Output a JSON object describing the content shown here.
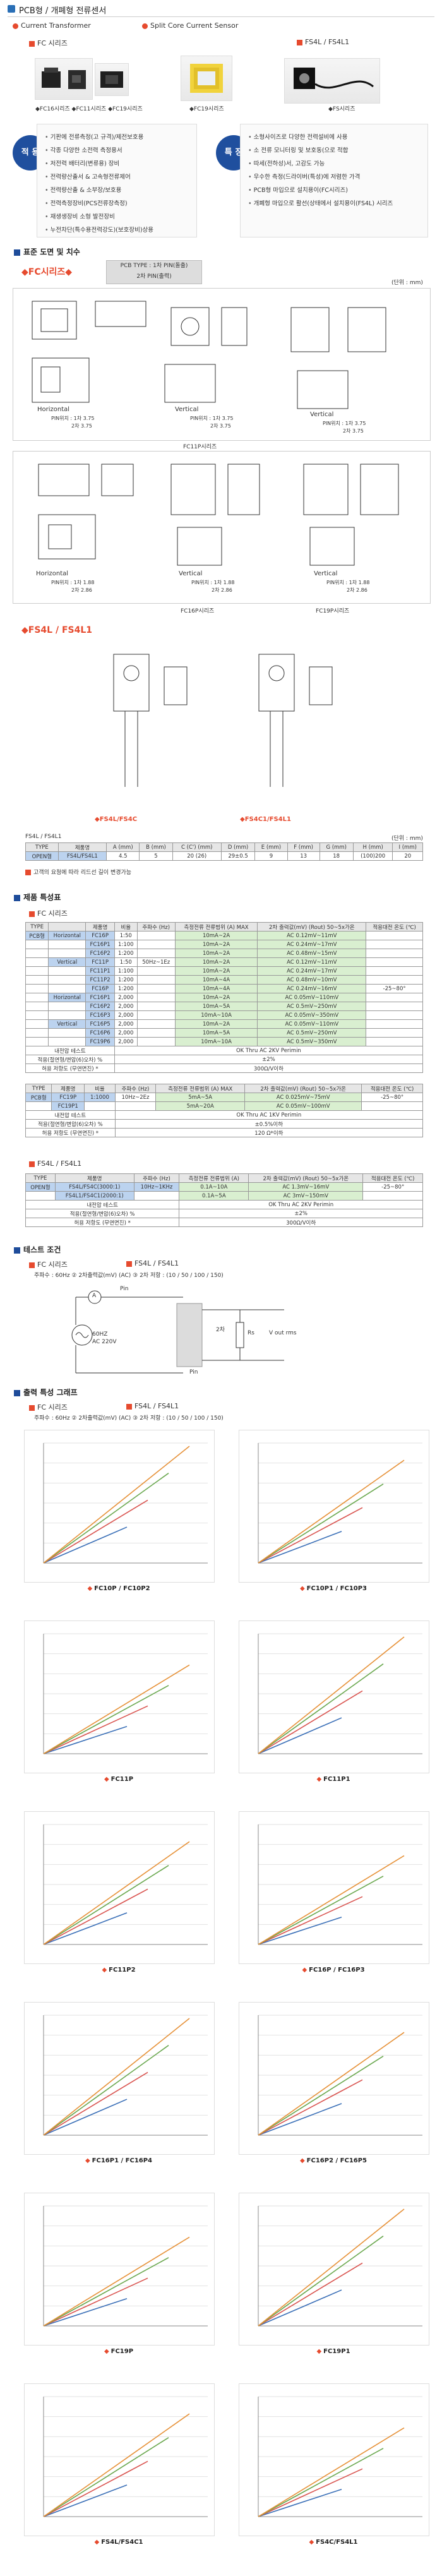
{
  "header": {
    "title": "PCB형 / 개폐형 전류센서"
  },
  "subtitle": {
    "ct": "Current Transformer",
    "split": "Split Core Current Sensor"
  },
  "series": {
    "fc": "FC 시리즈",
    "fs": "FS4L / FS4L1"
  },
  "photo_captions": {
    "fc": "◆FC16시리즈 ◆FC11시리즈 ◆FC19시리즈",
    "fc2": "◆FC19시리즈",
    "fs": "◆FS시리즈"
  },
  "features": {
    "use_label": "적 용",
    "feat_label": "특 징",
    "use_items": [
      "기판에 전류측정(고 규격)/제전보호용",
      "각종 다양한 소전력 측정용서",
      "저전력 배터리(변류용) 장비",
      "전력량산출서 & 고속형전류제어",
      "전력량산출 & 소부장/보호용",
      "전력측정장비(PCS전류장측정)",
      "재생생장비 소형 발전장비",
      "누전차단(특수용전력강도)(보호장비)상용"
    ],
    "feat_items": [
      "소형사이즈로 다양한 전력설비에 사용",
      "소 전류 모니터링 및 보호동(으로 적합",
      "따세(전하성)서, 고감도 가능",
      "우수한 측정(드라이버(특성)에 저렴한 가격",
      "PCB형 마입으로 설치용이(FC시리즈)",
      "개폐형 마입으로 활선(상태에서 설치용이(FS4L) 시리즈"
    ]
  },
  "s1": {
    "title": "표준 도면 및 치수",
    "fc_head": "FC시리즈",
    "pcb_type": [
      "PCB TYPE : 1차 PIN(돌출)",
      "2차 PIN(출력)"
    ],
    "unit": "(단위 : mm)",
    "d1": {
      "h": "Horizontal",
      "pin1": "PIN위치 : 1차 3.75",
      "pin2": "2차 3.75",
      "cap": "FC16P시리즈"
    },
    "d2": {
      "v": "Vertical",
      "pin1": "PIN위치 : 1차 3.75",
      "pin2": "2차 3.75",
      "cap": "FC11P시리즈"
    },
    "d3": {
      "v": "Vertical",
      "pin1": "PIN위치 : 1차 3.75",
      "pin2": "2차 3.75"
    },
    "d4": {
      "h": "Horizontal",
      "pin1": "PIN위치 : 1차 1.88",
      "pin2": "2차 2.86"
    },
    "d5": {
      "v": "Vertical",
      "pin1": "PIN위치 : 1차 1.88",
      "pin2": "2차 2.86",
      "cap": "FC16P시리즈"
    },
    "d6": {
      "v": "Vertical",
      "pin1": "PIN위치 : 1차 1.88",
      "pin2": "2차 2.86",
      "cap": "FC19P시리즈"
    },
    "fs_head": "FS4L / FS4L1",
    "fs_cap1": "FS4L/FS4C",
    "fs_cap2": "FS4C1/FS4L1",
    "fs_label": "FS4L / FS4L1",
    "fs_unit": "(단위 : mm)",
    "fs_table": {
      "headers": [
        "TYPE",
        "제품명",
        "A (mm)",
        "B (mm)",
        "C (C') (mm)",
        "D (mm)",
        "E (mm)",
        "F (mm)",
        "G (mm)",
        "H (mm)",
        "I (mm)"
      ],
      "row": [
        "OPEN형",
        "FS4L/FS4L1",
        "4.5",
        "5",
        "20 (26)",
        "29±0.5",
        "9",
        "13",
        "18",
        "(100)200",
        "20"
      ]
    },
    "note": "고객의 요청에 따라 리드선 길이 변경가능"
  },
  "s2": {
    "title": "제품 특성표",
    "fc": "FC 시리즈",
    "t1h": [
      "TYPE",
      "제품명",
      "비율",
      "주파수 (Hz)",
      "측정전류 전류범위 (A) MAX",
      "2차 출력값(mV) (Rout) 50~5x가온",
      "적용대전 온도 (℃)"
    ],
    "t1rows": [
      [
        "PCB형",
        "Horizontal",
        "FC16P",
        "1:50",
        "",
        "10mA~2A",
        "AC 0.12mV~11mV",
        ""
      ],
      [
        "",
        "",
        "FC16P1",
        "1:100",
        "",
        "10mA~2A",
        "AC 0.24mV~17mV",
        ""
      ],
      [
        "",
        "",
        "FC16P2",
        "1:200",
        "",
        "10mA~2A",
        "AC 0.48mV~15mV",
        ""
      ],
      [
        "",
        "Vertical",
        "FC11P",
        "1:50",
        "50Hz~1Ez",
        "10mA~2A",
        "AC 0.12mV~11mV",
        ""
      ],
      [
        "",
        "",
        "FC11P1",
        "1:100",
        "",
        "10mA~2A",
        "AC 0.24mV~17mV",
        ""
      ],
      [
        "",
        "",
        "FC11P2",
        "1:200",
        "",
        "10mA~4A",
        "AC 0.48mV~10mV",
        ""
      ],
      [
        "",
        "",
        "FC16P",
        "1:200",
        "",
        "10mA~4A",
        "AC 0.24mV~16mV",
        "-25~80°"
      ],
      [
        "",
        "Horizontal",
        "FC16P1",
        "2,000",
        "",
        "10mA~2A",
        "AC 0.05mV~110mV",
        ""
      ],
      [
        "",
        "",
        "FC16P2",
        "2,000",
        "",
        "10mA~5A",
        "AC 0.5mV~250mV",
        ""
      ],
      [
        "",
        "",
        "FC16P3",
        "2,000",
        "",
        "10mA~10A",
        "AC 0.05mV~350mV",
        ""
      ],
      [
        "",
        "Vertical",
        "FC16P5",
        "2,000",
        "",
        "10mA~2A",
        "AC 0.05mV~110mV",
        ""
      ],
      [
        "",
        "",
        "FC16P6",
        "2,000",
        "",
        "10mA~5A",
        "AC 0.5mV~250mV",
        ""
      ],
      [
        "",
        "",
        "FC19P6",
        "2,000",
        "",
        "10mA~10A",
        "AC 0.5mV~350mV",
        ""
      ]
    ],
    "t1foot": [
      [
        "내전압 테스트",
        "OK Thru AC 2KV Perimin"
      ],
      [
        "적용(절연형/변압(6)오차) %",
        "±2%"
      ],
      [
        "허용 저항도 (무연면진)  *",
        "300Ω/V이하"
      ]
    ],
    "t2h": [
      "TYPE",
      "제품명",
      "비율",
      "주파수 (Hz)",
      "측정전류 전류범위 (A) MAX",
      "2차 출력값(mV) (Rout) 50~5x가온",
      "적용대전 온도 (℃)"
    ],
    "t2rows": [
      [
        "PCB형",
        "FC19P",
        "1:1000",
        "10Hz~2Ez",
        "5mA~5A",
        "AC 0.025mV~75mV",
        "-25~80°"
      ],
      [
        "",
        "FC19P1",
        "",
        "",
        "5mA~20A",
        "AC 0.05mV~100mV",
        ""
      ]
    ],
    "t2foot": [
      [
        "내전압 테스트",
        "OK Thru AC 1KV Perimin"
      ],
      [
        "적용(절연형/변압(6)오차) %",
        "±0.5%이하"
      ],
      [
        "허용 저항도 (무연면진)  *",
        "120 Ω*이하"
      ]
    ],
    "fs": "FS4L / FS4L1",
    "t3h": [
      "TYPE",
      "제품명",
      "주파수 (Hz)",
      "측정전류 전류범위 (A)",
      "2차 출력값(mV) (Rout) 50~5x가온",
      "적용대전 온도 (℃)"
    ],
    "t3rows": [
      [
        "OPEN형",
        "FS4L/FS4C(3000:1)",
        "10Hz~1KHz",
        "0.1A~10A",
        "AC 1.3mV~16mV",
        "-25~80°"
      ],
      [
        "",
        "FS4L1/FS4C1(2000:1)",
        "",
        "0.1A~5A",
        "AC 3mV~150mV",
        ""
      ]
    ],
    "t3foot": [
      [
        "내전압 테스트",
        "OK Thru AC 2KV Perimin"
      ],
      [
        "적용(절연형/변압(6)오차) %",
        "±2%"
      ],
      [
        "허용 저항도 (무연면진)  *",
        "300Ω/V이하"
      ]
    ]
  },
  "s3": {
    "title": "테스트 조건",
    "fc": "FC 시리즈",
    "fs": "FS4L / FS4L1",
    "cond": "주파수 : 60Hz  ② 2차출력값(mV) (AC)  ③ 2차 저항 : (10 / 50 / 100 / 150)",
    "circuit": {
      "pin": "Pin",
      "a": "A",
      "freq": "60HZ",
      "ac": "AC 220V",
      "r2": "2차",
      "rs": "Rs",
      "vout": "V out rms",
      "pin2": "Pin"
    }
  },
  "s4": {
    "title": "출력 특성 그래프",
    "fc": "FC 시리즈",
    "fs": "FS4L / FS4L1",
    "cond": "주파수 : 60Hz  ② 2차출력값(mV) (AC)  ③ 2차 저항 : (10 / 50 / 100 / 150)",
    "caps": [
      "FC10P / FC10P2",
      "FC10P1 / FC10P3",
      "FC11P",
      "FC11P1",
      "FC11P2",
      "FC16P / FC16P3",
      "FC16P1 / FC16P4",
      "FC16P2 / FC16P5",
      "FC19P",
      "FC19P1",
      "FS4L/FS4C1",
      "FS4C/FS4L1"
    ]
  },
  "chart_data": [
    {
      "type": "line",
      "series": [
        {
          "values": [
            0,
            40,
            80,
            120,
            160,
            200
          ]
        },
        {
          "values": [
            0,
            70,
            140,
            210,
            280,
            350
          ]
        },
        {
          "values": [
            0,
            100,
            200,
            300,
            400,
            500
          ]
        },
        {
          "values": [
            0,
            130,
            260,
            390,
            520,
            650
          ]
        }
      ]
    }
  ],
  "colors": {
    "accent": "#e64a2e",
    "blue": "#1e4c9a",
    "series": [
      "#3a6fb7",
      "#d9534f",
      "#6aa84f",
      "#e69138"
    ]
  }
}
